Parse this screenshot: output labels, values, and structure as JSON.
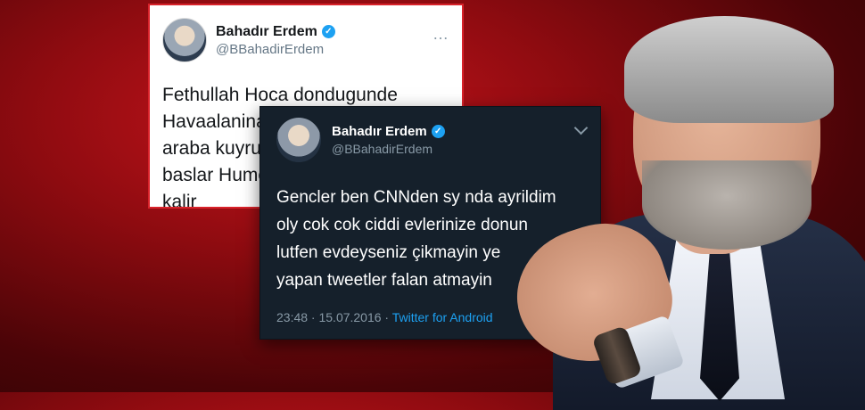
{
  "tweet_light": {
    "display_name": "Bahadır Erdem",
    "handle": "@BBahadirErdem",
    "more_icon": "…",
    "lines": [
      "Fethullah Hoca dondugunde",
      "Havaalanina",
      "araba kuyruk",
      "baslar Hume",
      "kalir"
    ]
  },
  "tweet_dark": {
    "display_name": "Bahadır Erdem",
    "handle": "@BBahadirErdem",
    "lines": [
      "Gencler ben CNNden sy nda ayrildim",
      "oly cok cok ciddi evlerinize donun",
      "lutfen evdeyseniz çikmayin ye",
      "yapan tweetler falan atmayin"
    ],
    "timestamp": "23:48 · 15.07.2016 · ",
    "source": "Twitter for Android"
  },
  "colors": {
    "twitter_blue": "#1da1f2",
    "dark_bg": "#15202b",
    "border_red": "#d8222a"
  }
}
